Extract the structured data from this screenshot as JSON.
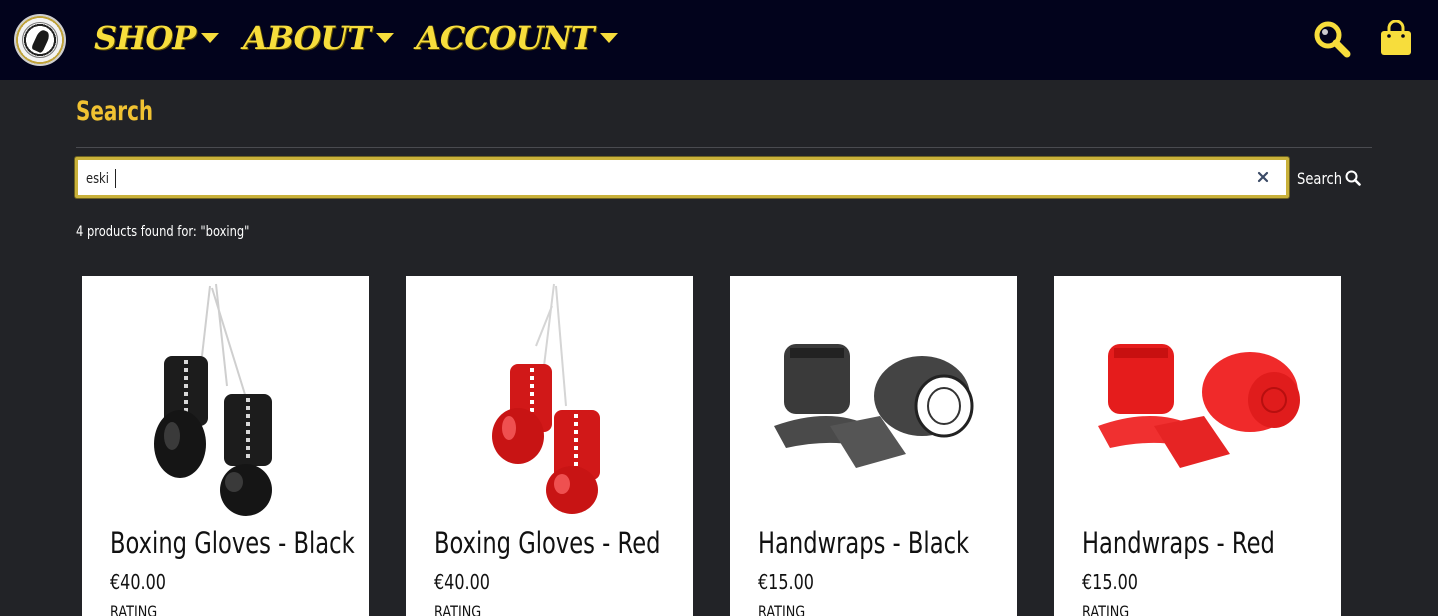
{
  "nav": {
    "shop_label": "SHOP",
    "about_label": "ABOUT",
    "account_label": "ACCOUNT",
    "accent_color": "#f7dd3c",
    "background_color": "#02031c"
  },
  "search": {
    "heading": "Search",
    "input_value": "eski",
    "button_label": "Search",
    "result_summary": "4 products found for: \"boxing\""
  },
  "products": [
    {
      "title": "Boxing Gloves - Black",
      "price": "€40.00",
      "rating_label": "RATING",
      "image": "black-boxing-gloves"
    },
    {
      "title": "Boxing Gloves - Red",
      "price": "€40.00",
      "rating_label": "RATING",
      "image": "red-boxing-gloves"
    },
    {
      "title": "Handwraps - Black",
      "price": "€15.00",
      "rating_label": "RATING",
      "image": "black-handwraps"
    },
    {
      "title": "Handwraps - Red",
      "price": "€15.00",
      "rating_label": "RATING",
      "image": "red-handwraps"
    }
  ]
}
